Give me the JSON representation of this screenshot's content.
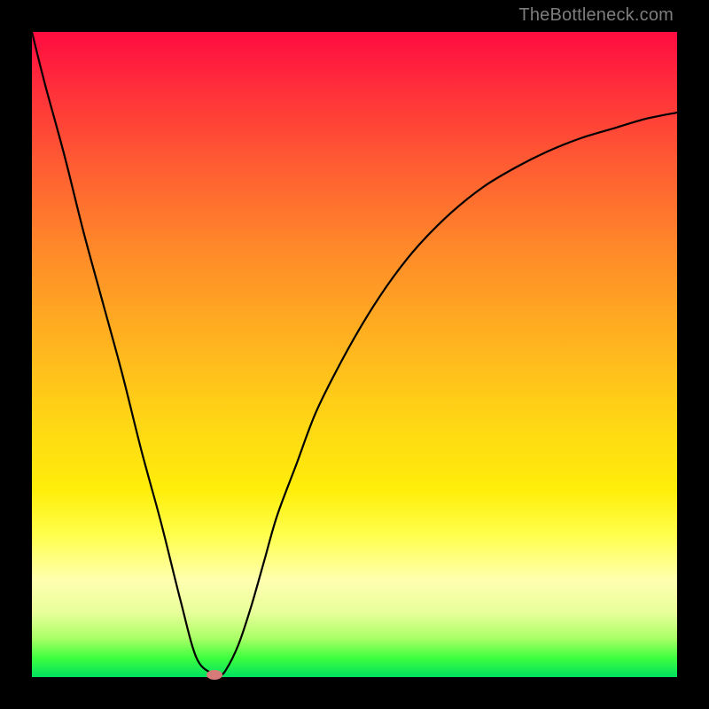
{
  "watermark": "TheBottleneck.com",
  "colors": {
    "frame": "#000000",
    "curve": "#000000",
    "marker": "#d77a7a",
    "gradient_stops": [
      "#ff0b40",
      "#ff2c3b",
      "#ff5a33",
      "#ff8a29",
      "#ffb31f",
      "#ffd515",
      "#ffee0a",
      "#ffff4d",
      "#ffffb0",
      "#e8ff9a",
      "#aaff66",
      "#3fff3f",
      "#00e060"
    ]
  },
  "chart_data": {
    "type": "line",
    "title": "",
    "xlabel": "",
    "ylabel": "",
    "xlim": [
      0,
      100
    ],
    "ylim": [
      0,
      100
    ],
    "x": [
      0,
      2,
      5,
      8,
      11,
      14,
      17,
      20,
      23,
      25.5,
      28,
      29,
      30,
      32,
      34,
      36,
      38,
      41,
      44,
      48,
      52,
      56,
      60,
      65,
      70,
      75,
      80,
      85,
      90,
      95,
      100
    ],
    "series": [
      {
        "name": "bottleneck-curve",
        "values": [
          100,
          92,
          81,
          69,
          58,
          47,
          35,
          24,
          12,
          3,
          0.5,
          0.3,
          1,
          5,
          11,
          18,
          25,
          33,
          41,
          49,
          56,
          62,
          67,
          72,
          76,
          79,
          81.5,
          83.5,
          85,
          86.5,
          87.5
        ]
      }
    ],
    "marker": {
      "x": 28.3,
      "y": 0.4
    },
    "grid": false,
    "legend": false
  }
}
